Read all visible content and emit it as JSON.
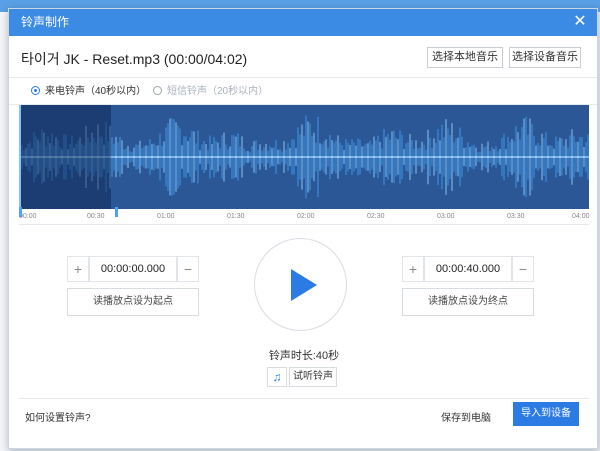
{
  "dialog": {
    "title": "铃声制作",
    "close_glyph": "✕",
    "file_title": "타이거 JK - Reset.mp3 (00:00/04:02)"
  },
  "actions": {
    "choose_local_music": "选择本地音乐",
    "choose_device_music": "选择设备音乐"
  },
  "ringtone_type": {
    "options": [
      {
        "label": "来电铃声（40秒以内）",
        "selected": true
      },
      {
        "label": "短信铃声（20秒以内）",
        "selected": false
      }
    ]
  },
  "timeline": {
    "ticks": [
      "00:00",
      "00:30",
      "01:00",
      "01:30",
      "02:00",
      "02:30",
      "03:00",
      "03:30",
      "04:00"
    ]
  },
  "start": {
    "minus_glyph": "+",
    "plus_glyph": "−",
    "value": "00:00:00.000",
    "set_label": "读播放点设为起点"
  },
  "end": {
    "minus_glyph": "+",
    "plus_glyph": "−",
    "value": "00:00:40.000",
    "set_label": "读播放点设为终点"
  },
  "player": {
    "duration_text": "铃声时长:40秒",
    "preview_icon": "music-note-icon",
    "preview_glyph": "♫",
    "preview_label": "试听铃声"
  },
  "footer": {
    "help_link": "如何设置铃声?",
    "save_to_pc": "保存到电脑",
    "import_to_device": "导入到设备"
  },
  "colors": {
    "accent": "#2c7be5",
    "titlebar": "#3b8ae3",
    "waveform": "#2b5797"
  }
}
